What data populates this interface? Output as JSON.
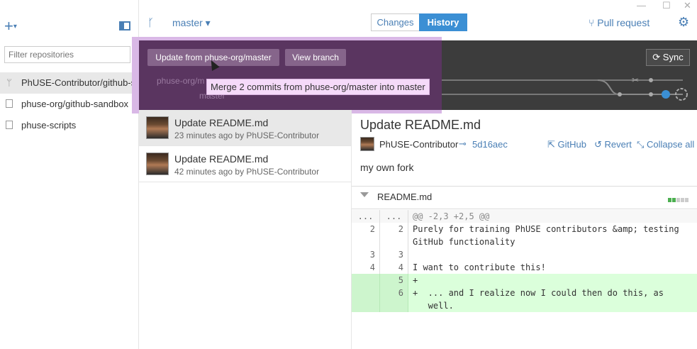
{
  "sidebar": {
    "filter_placeholder": "Filter repositories",
    "repos": [
      {
        "name": "PhUSE-Contributor/github-s...",
        "selected": true,
        "icon": "fork-icon"
      },
      {
        "name": "phuse-org/github-sandbox",
        "selected": false,
        "icon": "repo-icon"
      },
      {
        "name": "phuse-scripts",
        "selected": false,
        "icon": "repo-icon"
      }
    ]
  },
  "topbar": {
    "branch": "master",
    "tab_changes": "Changes",
    "tab_history": "History",
    "pull_request": "Pull request",
    "sync": "Sync"
  },
  "compare": {
    "update_button": "Update from phuse-org/master",
    "view_branch_button": "View branch",
    "ghost_upstream": "phuse-org/m",
    "ghost_master": "master",
    "tooltip": "Merge 2 commits from phuse-org/master into master"
  },
  "commits": [
    {
      "title": "Update README.md",
      "meta": "23 minutes ago by PhUSE-Contributor",
      "selected": true
    },
    {
      "title": "Update README.md",
      "meta": "42 minutes ago by PhUSE-Contributor",
      "selected": false
    }
  ],
  "detail": {
    "title": "Update README.md",
    "author": "PhUSE-Contributor",
    "sha": "5d16aec",
    "github": "GitHub",
    "revert": "Revert",
    "collapse_all": "Collapse all",
    "body": "my own fork",
    "file_name": "README.md"
  },
  "diff": [
    {
      "type": "hunk",
      "old": "...",
      "new": "...",
      "text": "@@ -2,3 +2,5 @@"
    },
    {
      "type": "ctx",
      "old": "2",
      "new": "2",
      "text": "Purely for training PhUSE contributors &amp; testing"
    },
    {
      "type": "ctx",
      "old": "",
      "new": "",
      "text": "GitHub functionality"
    },
    {
      "type": "ctx",
      "old": "3",
      "new": "3",
      "text": ""
    },
    {
      "type": "ctx",
      "old": "4",
      "new": "4",
      "text": "I want to contribute this!"
    },
    {
      "type": "add",
      "old": "",
      "new": "5",
      "text": "+"
    },
    {
      "type": "add",
      "old": "",
      "new": "6",
      "text": "+  ... and I realize now I could then do this, as"
    },
    {
      "type": "add",
      "old": "",
      "new": "",
      "text": "   well."
    }
  ],
  "colors": {
    "accent": "#3b8fd4",
    "link": "#4a7fb5",
    "add_bg": "#dbffdb",
    "compare_bg": "#5a3560",
    "graph_dot": "#3b8fd4"
  }
}
